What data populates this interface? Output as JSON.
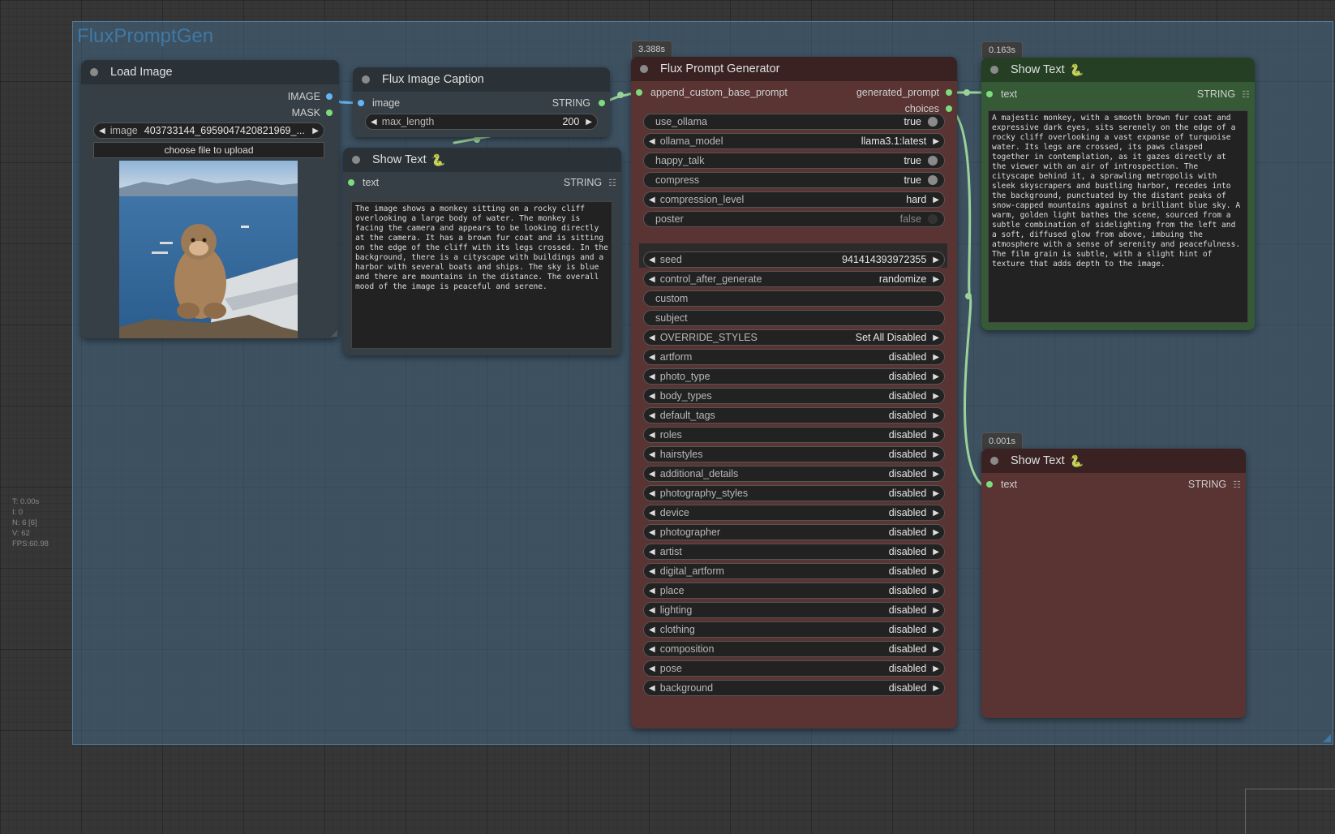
{
  "group": {
    "title": "FluxPromptGen"
  },
  "stats": [
    "T: 0.00s",
    "I: 0",
    "N: 6 [6]",
    "V: 62",
    "FPS:60.98"
  ],
  "load_image": {
    "title": "Load Image",
    "outputs": [
      "IMAGE",
      "MASK"
    ],
    "image_label": "image",
    "image_value": "403733144_6959047420821969_...",
    "upload_label": "choose file to upload",
    "preview_icon": "monkey-photo"
  },
  "caption": {
    "title": "Flux Image Caption",
    "input": "image",
    "output": "STRING",
    "max_length_label": "max_length",
    "max_length_value": "200"
  },
  "show_text_1": {
    "title": "Show Text",
    "input": "text",
    "output": "STRING",
    "text": "The image shows a monkey sitting on a rocky cliff overlooking a large body of water. The monkey is facing the camera and appears to be looking directly at the camera. It has a brown fur coat and is sitting on the edge of the cliff with its legs crossed. In the background, there is a cityscape with buildings and a harbor with several boats and ships. The sky is blue and there are mountains in the distance. The overall mood of the image is peaceful and serene."
  },
  "generator": {
    "timing": "3.388s",
    "title": "Flux Prompt Generator",
    "input": "append_custom_base_prompt",
    "outputs": [
      "generated_prompt",
      "choices"
    ],
    "toggles": [
      {
        "label": "use_ollama",
        "value": "true",
        "on": true
      },
      {
        "label": "ollama_model",
        "value": "llama3.1:latest",
        "combo": true
      },
      {
        "label": "happy_talk",
        "value": "true",
        "on": true
      },
      {
        "label": "compress",
        "value": "true",
        "on": true
      },
      {
        "label": "compression_level",
        "value": "hard",
        "combo": true
      },
      {
        "label": "poster",
        "value": "false",
        "on": false
      }
    ],
    "seed_label": "seed",
    "seed_value": "941414393972355",
    "cag_label": "control_after_generate",
    "cag_value": "randomize",
    "custom_label": "custom",
    "subject_label": "subject",
    "styles": [
      {
        "label": "OVERRIDE_STYLES",
        "value": "Set All Disabled"
      },
      {
        "label": "artform",
        "value": "disabled"
      },
      {
        "label": "photo_type",
        "value": "disabled"
      },
      {
        "label": "body_types",
        "value": "disabled"
      },
      {
        "label": "default_tags",
        "value": "disabled"
      },
      {
        "label": "roles",
        "value": "disabled"
      },
      {
        "label": "hairstyles",
        "value": "disabled"
      },
      {
        "label": "additional_details",
        "value": "disabled"
      },
      {
        "label": "photography_styles",
        "value": "disabled"
      },
      {
        "label": "device",
        "value": "disabled"
      },
      {
        "label": "photographer",
        "value": "disabled"
      },
      {
        "label": "artist",
        "value": "disabled"
      },
      {
        "label": "digital_artform",
        "value": "disabled"
      },
      {
        "label": "place",
        "value": "disabled"
      },
      {
        "label": "lighting",
        "value": "disabled"
      },
      {
        "label": "clothing",
        "value": "disabled"
      },
      {
        "label": "composition",
        "value": "disabled"
      },
      {
        "label": "pose",
        "value": "disabled"
      },
      {
        "label": "background",
        "value": "disabled"
      }
    ]
  },
  "show_text_2": {
    "timing": "0.163s",
    "title": "Show Text",
    "input": "text",
    "output": "STRING",
    "text": "A majestic monkey, with a smooth brown fur coat and expressive dark eyes, sits serenely on the edge of a rocky cliff overlooking a vast expanse of turquoise water. Its legs are crossed, its paws clasped together in contemplation, as it gazes directly at the viewer with an air of introspection. The cityscape behind it, a sprawling metropolis with sleek skyscrapers and bustling harbor, recedes into the background, punctuated by the distant peaks of snow-capped mountains against a brilliant blue sky. A warm, golden light bathes the scene, sourced from a subtle combination of sidelighting from the left and a soft, diffused glow from above, imbuing the atmosphere with a sense of serenity and peacefulness. The film grain is subtle, with a slight hint of texture that adds depth to the image."
  },
  "show_text_3": {
    "timing": "0.001s",
    "title": "Show Text",
    "input": "text",
    "output": "STRING"
  },
  "colors": {
    "node_grey": "#353f45",
    "node_red": "#5a3333",
    "node_green": "#355a35"
  }
}
